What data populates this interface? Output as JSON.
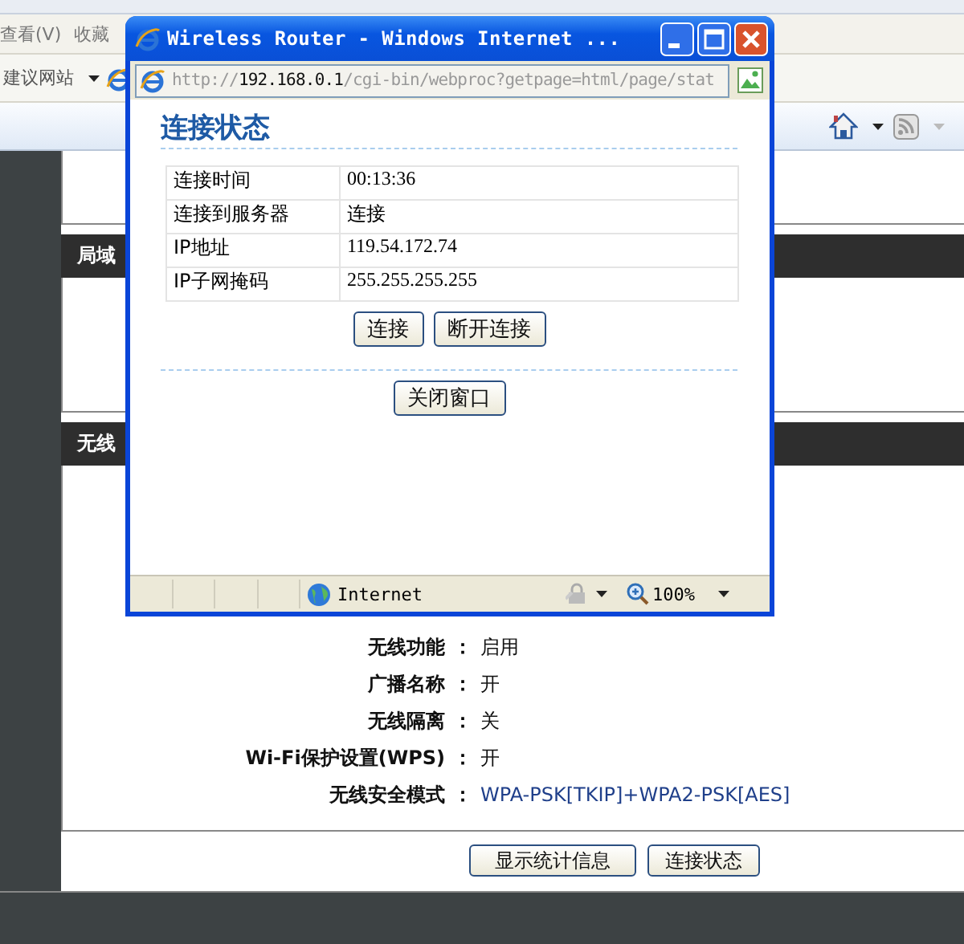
{
  "browser": {
    "menu": [
      {
        "label": "查看(V)"
      },
      {
        "label": "收藏"
      }
    ],
    "links_bar": {
      "label": "建议网站"
    }
  },
  "page": {
    "sections": [
      {
        "header": "局域"
      },
      {
        "header": "无线"
      }
    ],
    "wireless_rows": [
      {
        "label": "无线功能",
        "value": "启用"
      },
      {
        "label": "广播名称",
        "value": "开"
      },
      {
        "label": "无线隔离",
        "value": "关"
      },
      {
        "label": "Wi-Fi保护设置(WPS)",
        "value": "开"
      },
      {
        "label": "无线安全模式",
        "value": "WPA-PSK[TKIP]+WPA2-PSK[AES]",
        "kind": "link"
      }
    ],
    "separator": "：",
    "buttons": [
      {
        "label": "显示统计信息"
      },
      {
        "label": "连接状态"
      }
    ]
  },
  "popup": {
    "title": "Wireless Router - Windows Internet ...",
    "address": {
      "scheme": "http://",
      "host": "192.168.0.1",
      "path": "/cgi-bin/webproc?getpage=html/page/stat"
    },
    "heading": "连接状态",
    "rows": [
      {
        "label": "连接时间",
        "value": "00:13:36"
      },
      {
        "label": "连接到服务器",
        "value": "连接"
      },
      {
        "label": "IP地址",
        "value": "119.54.172.74"
      },
      {
        "label": "IP子网掩码",
        "value": "255.255.255.255"
      }
    ],
    "buttons": [
      {
        "label": "连接"
      },
      {
        "label": "断开连接"
      }
    ],
    "close_button": {
      "label": "关闭窗口"
    },
    "status_bar": {
      "zone": "Internet",
      "zoom": "100%"
    }
  }
}
